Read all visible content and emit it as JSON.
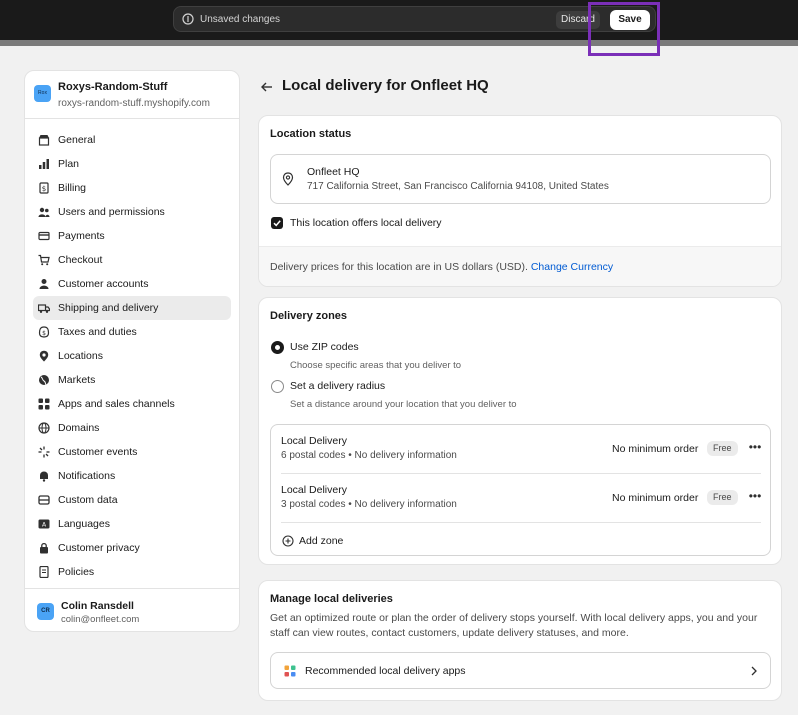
{
  "top_bar": {
    "unsaved_label": "Unsaved changes",
    "discard_label": "Discard",
    "save_label": "Save",
    "highlight_color": "#7b2fb8"
  },
  "sidebar": {
    "store_avatar": "Rox",
    "store_name": "Roxys-Random-Stuff",
    "store_domain": "roxys-random-stuff.myshopify.com",
    "items": [
      {
        "label": "General",
        "icon": "store-icon"
      },
      {
        "label": "Plan",
        "icon": "plan-icon"
      },
      {
        "label": "Billing",
        "icon": "billing-icon"
      },
      {
        "label": "Users and permissions",
        "icon": "users-icon"
      },
      {
        "label": "Payments",
        "icon": "payments-icon"
      },
      {
        "label": "Checkout",
        "icon": "cart-icon"
      },
      {
        "label": "Customer accounts",
        "icon": "person-icon"
      },
      {
        "label": "Shipping and delivery",
        "icon": "truck-icon",
        "active": true
      },
      {
        "label": "Taxes and duties",
        "icon": "tax-icon"
      },
      {
        "label": "Locations",
        "icon": "location-icon"
      },
      {
        "label": "Markets",
        "icon": "globe-icon"
      },
      {
        "label": "Apps and sales channels",
        "icon": "apps-icon"
      },
      {
        "label": "Domains",
        "icon": "domain-icon"
      },
      {
        "label": "Customer events",
        "icon": "events-icon"
      },
      {
        "label": "Notifications",
        "icon": "bell-icon"
      },
      {
        "label": "Custom data",
        "icon": "database-icon"
      },
      {
        "label": "Languages",
        "icon": "language-icon"
      },
      {
        "label": "Customer privacy",
        "icon": "lock-icon"
      },
      {
        "label": "Policies",
        "icon": "policy-icon"
      }
    ],
    "user": {
      "initials": "CR",
      "name": "Colin Ransdell",
      "email": "colin@onfleet.com"
    }
  },
  "main": {
    "page_title": "Local delivery for Onfleet HQ",
    "location_status": {
      "title": "Location status",
      "location_name": "Onfleet HQ",
      "location_address": "717 California Street, San Francisco California 94108, United States",
      "checkbox_label": "This location offers local delivery",
      "checkbox_checked": true,
      "price_note": "Delivery prices for this location are in US dollars (USD).",
      "change_currency_label": "Change Currency"
    },
    "delivery_zones": {
      "title": "Delivery zones",
      "options": [
        {
          "label": "Use ZIP codes",
          "help": "Choose specific areas that you deliver to",
          "selected": true
        },
        {
          "label": "Set a delivery radius",
          "help": "Set a distance around your location that you deliver to",
          "selected": false
        }
      ],
      "zones": [
        {
          "name": "Local Delivery",
          "detail": "6 postal codes • No delivery information",
          "minimum": "No minimum order",
          "badge": "Free"
        },
        {
          "name": "Local Delivery",
          "detail": "3 postal codes • No delivery information",
          "minimum": "No minimum order",
          "badge": "Free"
        }
      ],
      "add_zone_label": "Add zone",
      "more_label": "•••"
    },
    "manage": {
      "title": "Manage local deliveries",
      "description": "Get an optimized route or plan the order of delivery stops yourself. With local delivery apps, you and your staff can view routes, contact customers, update delivery statuses, and more.",
      "recommended_label": "Recommended local delivery apps"
    }
  }
}
